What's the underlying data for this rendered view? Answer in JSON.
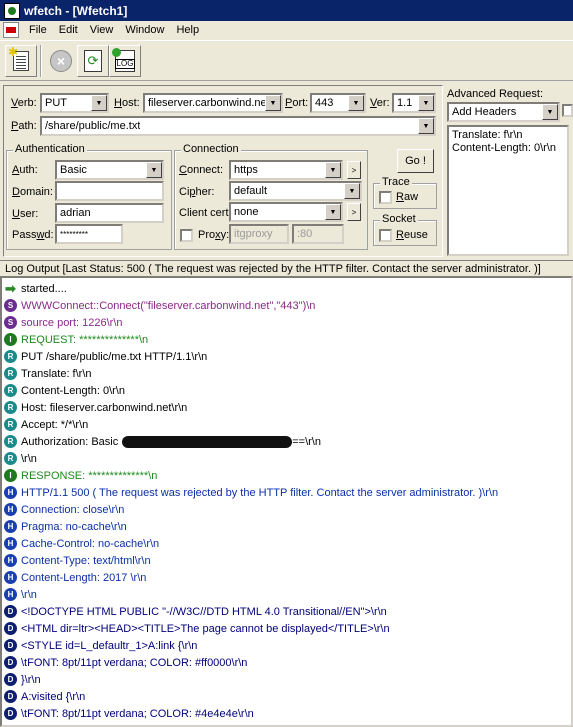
{
  "window": {
    "title": "wfetch - [Wfetch1]"
  },
  "menu": [
    "File",
    "Edit",
    "View",
    "Window",
    "Help"
  ],
  "toolbar": {
    "log_label": "LOG"
  },
  "request": {
    "verb_label": "Verb:",
    "verb": "PUT",
    "host_label": "Host:",
    "host": "fileserver.carbonwind.net",
    "port_label": "Port:",
    "port": "443",
    "ver_label": "Ver:",
    "ver": "1.1",
    "path_label": "Path:",
    "path": "/share/public/me.txt"
  },
  "authentication": {
    "title": "Authentication",
    "auth_label": "Auth:",
    "auth": "Basic",
    "domain_label": "Domain:",
    "domain": "",
    "user_label": "User:",
    "user": "adrian",
    "passwd_label": "Passwd:",
    "passwd": "*********"
  },
  "connection": {
    "title": "Connection",
    "connect_label": "Connect:",
    "connect": "https",
    "cipher_label": "Cipher:",
    "cipher": "default",
    "client_cert_label": "Client cert:",
    "client_cert": "none",
    "proxy_label": "Proxy:",
    "proxy_host": "itgproxy",
    "proxy_port": ":80",
    "more": ">"
  },
  "go_button": "Go !",
  "trace": {
    "title": "Trace",
    "raw_label": "Raw"
  },
  "socket": {
    "title": "Socket",
    "reuse_label": "Reuse"
  },
  "advanced": {
    "title": "Advanced Request:",
    "dropdown": "Add Headers",
    "headers_line1": "Translate: f\\r\\n",
    "headers_line2": "Content-Length: 0\\r\\n"
  },
  "log": {
    "header": "Log Output [Last Status: 500 ( The request was rejected by the HTTP filter. Contact the server administrator.  )]",
    "lines": [
      {
        "badge": "arrow",
        "color": "#000000",
        "text": "started...."
      },
      {
        "badge": "S",
        "color": "#8a2a8a",
        "text": "WWWConnect::Connect(\"fileserver.carbonwind.net\",\"443\")\\n"
      },
      {
        "badge": "S",
        "color": "#8a2a8a",
        "text": "source port: 1226\\r\\n"
      },
      {
        "badge": "I",
        "color": "#1e8a1e",
        "text": "REQUEST: **************\\n"
      },
      {
        "badge": "R",
        "color": "#000000",
        "text": "PUT /share/public/me.txt HTTP/1.1\\r\\n"
      },
      {
        "badge": "R",
        "color": "#000000",
        "text": "Translate: f\\r\\n"
      },
      {
        "badge": "R",
        "color": "#000000",
        "text": "Content-Length: 0\\r\\n"
      },
      {
        "badge": "R",
        "color": "#000000",
        "text": "Host: fileserver.carbonwind.net\\r\\n"
      },
      {
        "badge": "R",
        "color": "#000000",
        "text": "Accept: */*\\r\\n"
      },
      {
        "badge": "R",
        "color": "#000000",
        "text": "Authorization: Basic",
        "redacted": true,
        "text2": "==\\r\\n"
      },
      {
        "badge": "R",
        "color": "#000000",
        "text": "\\r\\n"
      },
      {
        "badge": "I",
        "color": "#1e8a1e",
        "text": "RESPONSE: **************\\n"
      },
      {
        "badge": "H",
        "color": "#0b2fa8",
        "text": "HTTP/1.1 500 ( The request was rejected by the HTTP filter. Contact the server administrator.  )\\r\\n"
      },
      {
        "badge": "H",
        "color": "#0b2fa8",
        "text": "Connection: close\\r\\n"
      },
      {
        "badge": "H",
        "color": "#0b2fa8",
        "text": "Pragma: no-cache\\r\\n"
      },
      {
        "badge": "H",
        "color": "#0b2fa8",
        "text": "Cache-Control: no-cache\\r\\n"
      },
      {
        "badge": "H",
        "color": "#0b2fa8",
        "text": "Content-Type: text/html\\r\\n"
      },
      {
        "badge": "H",
        "color": "#0b2fa8",
        "text": "Content-Length: 2017  \\r\\n"
      },
      {
        "badge": "H",
        "color": "#0b2fa8",
        "text": "\\r\\n"
      },
      {
        "badge": "D",
        "color": "#00007a",
        "text": "<!DOCTYPE HTML PUBLIC \"-//W3C//DTD HTML 4.0 Transitional//EN\">\\r\\n"
      },
      {
        "badge": "D",
        "color": "#00007a",
        "text": "<HTML dir=ltr><HEAD><TITLE>The page cannot be displayed</TITLE>\\r\\n"
      },
      {
        "badge": "D",
        "color": "#00007a",
        "text": "<STYLE id=L_defaultr_1>A:link {\\r\\n"
      },
      {
        "badge": "D",
        "color": "#00007a",
        "text": "\\tFONT: 8pt/11pt verdana; COLOR: #ff0000\\r\\n"
      },
      {
        "badge": "D",
        "color": "#00007a",
        "text": "}\\r\\n"
      },
      {
        "badge": "D",
        "color": "#00007a",
        "text": "A:visited {\\r\\n"
      },
      {
        "badge": "D",
        "color": "#00007a",
        "text": "\\tFONT: 8pt/11pt verdana; COLOR: #4e4e4e\\r\\n"
      }
    ]
  },
  "badge_colors": {
    "S": "#6b2d8f",
    "I": "#1e7a1e",
    "R": "#1a8a8a",
    "H": "#1a3fb0",
    "D": "#0d1f6e"
  }
}
